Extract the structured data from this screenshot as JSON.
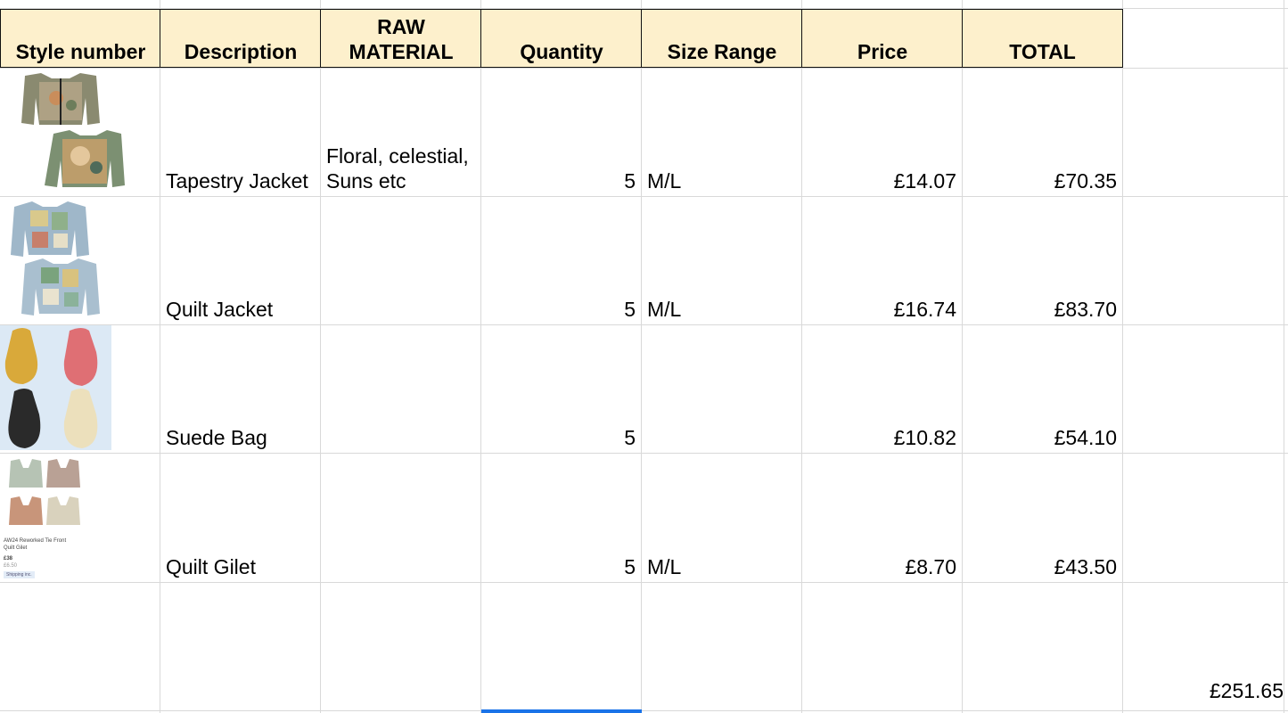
{
  "headers": {
    "style_number": "Style number",
    "description": "Description",
    "raw_material_line1": "RAW",
    "raw_material_line2": "MATERIAL",
    "quantity": "Quantity",
    "size_range": "Size Range",
    "price": "Price",
    "total": "TOTAL"
  },
  "rows": [
    {
      "image": "tapestry-jacket-thumbnail",
      "description": "Tapestry Jacket",
      "raw_material_line1": "Floral, celestial,",
      "raw_material_line2": "Suns etc",
      "quantity": "5",
      "size_range": "M/L",
      "price": "£14.07",
      "total": "£70.35"
    },
    {
      "image": "quilt-jacket-thumbnail",
      "description": "Quilt Jacket",
      "raw_material_line1": "",
      "raw_material_line2": "",
      "quantity": "5",
      "size_range": "M/L",
      "price": "£16.74",
      "total": "£83.70"
    },
    {
      "image": "suede-bag-thumbnail",
      "description": "Suede Bag",
      "raw_material_line1": "",
      "raw_material_line2": "",
      "quantity": "5",
      "size_range": "",
      "price": "£10.82",
      "total": "£54.10"
    },
    {
      "image": "quilt-gilet-thumbnail",
      "description": "Quilt Gilet",
      "raw_material_line1": "",
      "raw_material_line2": "",
      "quantity": "5",
      "size_range": "M/L",
      "price": "£8.70",
      "total": "£43.50",
      "image_caption_1": "AW24 Reworked Tie Front",
      "image_caption_2": "Quilt Gilet",
      "image_price": "£38",
      "image_subprice": "£6.50",
      "image_badge": "Shipping inc."
    }
  ],
  "grand_total": "£251.65",
  "colors": {
    "header_bg": "#fdf0cc",
    "grid": "#d9d9d9",
    "selection": "#1a73e8"
  }
}
